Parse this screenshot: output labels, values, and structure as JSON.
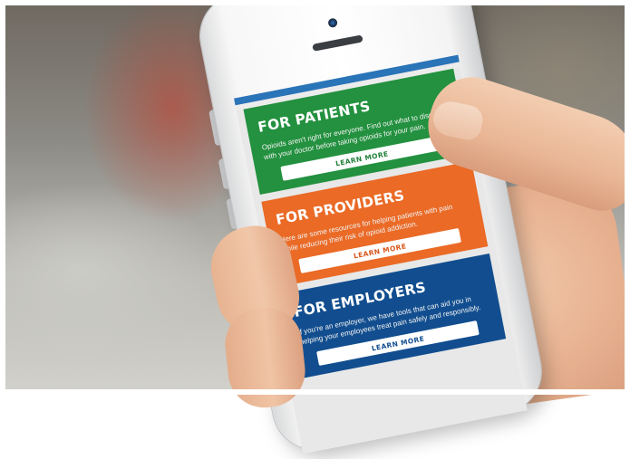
{
  "cards": [
    {
      "title": "FOR PATIENTS",
      "text": "Opioids aren't right for everyone. Find out what to discuss with your doctor before taking opioids for your pain.",
      "button": "LEARN MORE"
    },
    {
      "title": "FOR PROVIDERS",
      "text": "Here are some resources for helping patients with pain while reducing their risk of opioid addiction.",
      "button": "LEARN MORE"
    },
    {
      "title": "FOR EMPLOYERS",
      "text": "If you're an employer, we have tools that can aid you in helping your employees treat pain safely and responsibly.",
      "button": "LEARN MORE"
    }
  ],
  "colors": {
    "patients": "#23913f",
    "providers": "#ea6a26",
    "employers": "#124e8f",
    "top_bar": "#2a74b8"
  }
}
